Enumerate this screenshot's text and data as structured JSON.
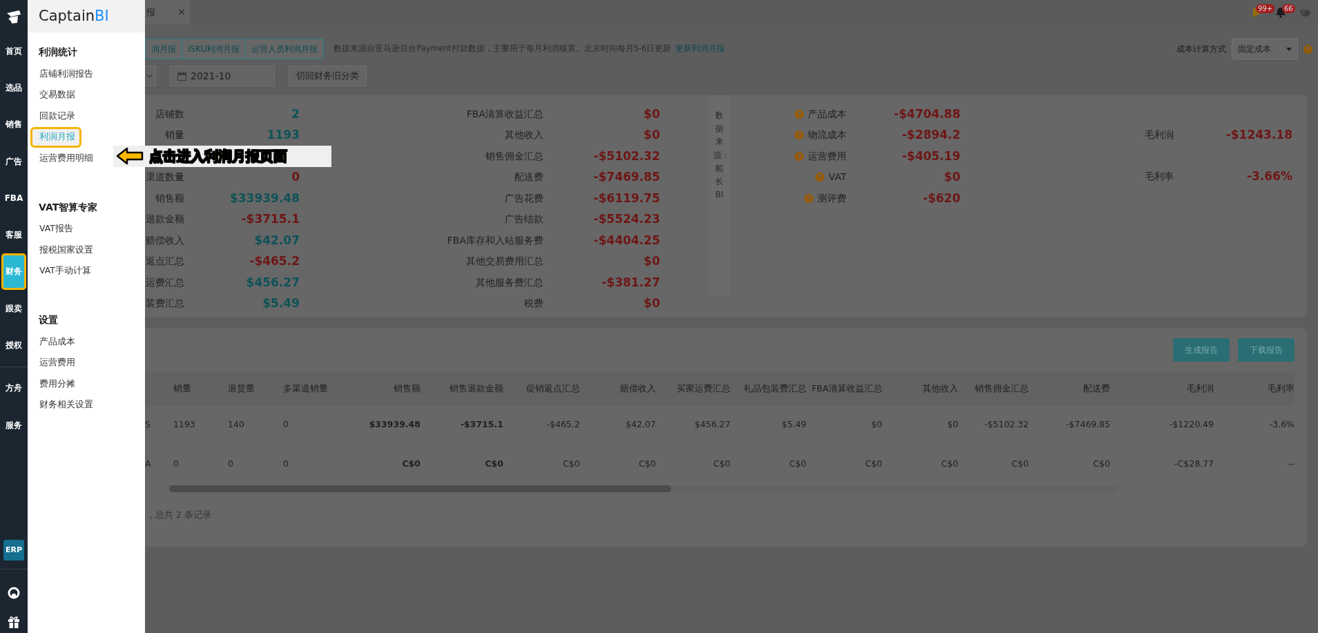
{
  "rail": {
    "sections": [
      {
        "items": [
          {
            "label": "首页",
            "selected": false,
            "highlighted": false
          },
          {
            "label": "选品",
            "selected": false,
            "highlighted": false
          },
          {
            "label": "销售",
            "selected": false,
            "highlighted": false
          },
          {
            "label": "广告",
            "selected": false,
            "highlighted": false
          },
          {
            "label": "FBA",
            "selected": false,
            "highlighted": false
          },
          {
            "label": "客服",
            "selected": false,
            "highlighted": false
          },
          {
            "label": "财务",
            "selected": true,
            "highlighted": true
          },
          {
            "label": "跟卖",
            "selected": false,
            "highlighted": false
          },
          {
            "label": "授权",
            "selected": false,
            "highlighted": false
          }
        ]
      },
      {
        "items": [
          {
            "label": "方舟",
            "selected": false,
            "highlighted": false
          },
          {
            "label": "服务",
            "selected": false,
            "highlighted": false
          }
        ]
      }
    ],
    "erp": "ERP"
  },
  "menu": {
    "logo": {
      "main": "Captain",
      "accent": "BI"
    },
    "sections": [
      {
        "title": "利润统计",
        "items": [
          {
            "label": "店铺利润报告",
            "selected": false,
            "highlighted": false
          },
          {
            "label": "交易数据",
            "selected": false,
            "highlighted": false
          },
          {
            "label": "回款记录",
            "selected": false,
            "highlighted": false
          },
          {
            "label": "利润月报",
            "selected": true,
            "highlighted": true
          },
          {
            "label": "运营费用明细",
            "selected": false,
            "highlighted": false
          }
        ]
      },
      {
        "title": "VAT智算专家",
        "items": [
          {
            "label": "VAT报告",
            "selected": false,
            "highlighted": false
          },
          {
            "label": "报税国家设置",
            "selected": false,
            "highlighted": false
          },
          {
            "label": "VAT手动计算",
            "selected": false,
            "highlighted": false
          }
        ]
      },
      {
        "title": "设置",
        "items": [
          {
            "label": "产品成本",
            "selected": false,
            "highlighted": false
          },
          {
            "label": "运营费用",
            "selected": false,
            "highlighted": false
          },
          {
            "label": "费用分摊",
            "selected": false,
            "highlighted": false
          },
          {
            "label": "财务相关设置",
            "selected": false,
            "highlighted": false
          }
        ]
      }
    ]
  },
  "top_bar": {
    "tab": {
      "label": "报",
      "close": "×"
    },
    "play_badge": "99+",
    "bell_badge": "66"
  },
  "header": {
    "report_tabs": [
      "润月报",
      "iSKU利润月报",
      "运营人员利润月报"
    ],
    "note": "数据来源自亚马逊后台Payment付款数据，主要用于每月利润核算。北京时间每月5-6日更新",
    "note_link": "更新利润月报",
    "cost_label": "成本计算方式",
    "cost_select": "固定成本"
  },
  "filters": {
    "date": "2021-10",
    "old_button": "切回财务旧分类"
  },
  "stats": {
    "groups": [
      {
        "kind": "list",
        "items": [
          {
            "kind": "stat",
            "label": "店铺数",
            "value": "2",
            "color": "#0f5257"
          },
          {
            "kind": "stat",
            "label": "销量",
            "value": "1193",
            "color": "#0f5257"
          },
          {
            "kind": "callout",
            "text": "点击进入利润月报页面"
          },
          {
            "kind": "stat",
            "label": "渠道数量",
            "value": "0",
            "color": "#6e1616"
          },
          {
            "kind": "stat",
            "label": "销售额",
            "value": "$33939.48",
            "color": "#0f5257"
          },
          {
            "kind": "stat",
            "label": "退款金额",
            "value": "-$3715.1",
            "color": "#6e1616"
          },
          {
            "kind": "stat",
            "label": "赔偿收入",
            "value": "$42.07",
            "color": "#0f5257"
          },
          {
            "kind": "stat",
            "label": "返点汇总",
            "value": "-$465.2",
            "color": "#6e1616"
          },
          {
            "kind": "stat",
            "label": "运费汇总",
            "value": "$456.27",
            "color": "#0f5257"
          },
          {
            "kind": "stat",
            "label": "装费汇总",
            "value": "$5.49",
            "color": "#0f5257"
          }
        ]
      },
      {
        "kind": "list",
        "items": [
          {
            "kind": "stat",
            "label": "FBA清算收益汇总",
            "value": "$0",
            "color": "#6e1616"
          },
          {
            "kind": "stat",
            "label": "其他收入",
            "value": "$0",
            "color": "#6e1616"
          },
          {
            "kind": "stat",
            "label": "销售佣金汇总",
            "value": "-$5102.32",
            "color": "#6e1616"
          },
          {
            "kind": "stat",
            "label": "配送费",
            "value": "-$7469.85",
            "color": "#6e1616"
          },
          {
            "kind": "stat",
            "label": "广告花费",
            "value": "-$6119.75",
            "color": "#6e1616"
          },
          {
            "kind": "stat",
            "label": "广告结款",
            "value": "-$5524.23",
            "color": "#6e1616"
          },
          {
            "kind": "stat",
            "label": "FBA库存和入站服务费",
            "value": "-$4404.25",
            "color": "#6e1616"
          },
          {
            "kind": "stat",
            "label": "其他交易费用汇总",
            "value": "$0",
            "color": "#6e1616"
          },
          {
            "kind": "stat",
            "label": "其他服务费汇总",
            "value": "-$381.27",
            "color": "#6e1616"
          },
          {
            "kind": "stat",
            "label": "税费",
            "value": "$0",
            "color": "#6e1616"
          }
        ]
      },
      {
        "kind": "source",
        "text": "数据来源：船长BI"
      },
      {
        "kind": "help",
        "items": [
          {
            "kind": "stat",
            "label": "产品成本",
            "value": "-$4704.88",
            "color": "#6e1616"
          },
          {
            "kind": "stat",
            "label": "物流成本",
            "value": "-$2894.2",
            "color": "#6e1616"
          },
          {
            "kind": "stat",
            "label": "运营费用",
            "value": "-$405.19",
            "color": "#6e1616"
          },
          {
            "kind": "stat",
            "label": "VAT",
            "value": "$0",
            "color": "#6e1616"
          },
          {
            "kind": "stat",
            "label": "测评费",
            "value": "-$620",
            "color": "#6e1616"
          }
        ]
      },
      {
        "kind": "summary",
        "items": [
          {
            "kind": "stat",
            "label": "毛利润",
            "value": "-$1243.18",
            "color": "#6e1616"
          },
          {
            "kind": "stat",
            "label": "毛利率",
            "value": "-3.66%",
            "color": "#6e1616"
          }
        ]
      }
    ]
  },
  "table": {
    "buttons": [
      "生成报告",
      "下载报告"
    ],
    "columns": [
      {},
      {
        "label": "销量"
      },
      {
        "label": "退货量"
      },
      {
        "label": "多渠道销量"
      },
      {
        "label": "销售额"
      },
      {
        "label": "销售退款金额"
      },
      {
        "label": "促销返点汇总"
      },
      {
        "label": "赔偿收入"
      },
      {
        "label": "买家运费汇总"
      },
      {
        "label": "礼品包装费汇总"
      },
      {
        "label": "FBA清算收益汇总"
      },
      {
        "label": "其他收入"
      },
      {
        "label": "销售佣金汇总"
      },
      {
        "label": "配送费"
      },
      {
        "label": "毛利润"
      },
      {
        "label": "毛利率"
      }
    ],
    "rows": [
      [
        "S",
        "1193",
        "140",
        "0",
        "$33939.48",
        "-$3715.1",
        "-$465.2",
        "$42.07",
        "$456.27",
        "$5.49",
        "$0",
        "$0",
        "-$5102.32",
        "-$7469.85",
        "-$1220.49",
        "-3.6%"
      ],
      [
        "A",
        "0",
        "0",
        "0",
        "C$0",
        "C$0",
        "C$0",
        "C$0",
        "C$0",
        "C$0",
        "C$0",
        "C$0",
        "C$0",
        "C$0",
        "-C$28.77",
        "--"
      ]
    ],
    "footer": "，总共 2 条记录"
  }
}
